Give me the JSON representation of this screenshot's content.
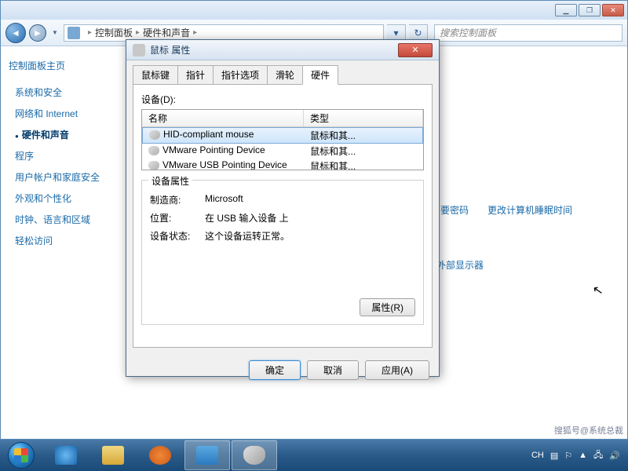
{
  "explorer": {
    "breadcrumb": {
      "seg1": "控制面板",
      "seg2": "硬件和声音"
    },
    "search_placeholder": "搜索控制面板",
    "sidebar": {
      "title": "控制面板主页",
      "items": [
        {
          "label": "系统和安全"
        },
        {
          "label": "网络和 Internet"
        },
        {
          "label": "硬件和声音"
        },
        {
          "label": "程序"
        },
        {
          "label": "用户帐户和家庭安全"
        },
        {
          "label": "外观和个性化"
        },
        {
          "label": "时钟、语言和区域"
        },
        {
          "label": "轻松访问"
        }
      ],
      "active_index": 2
    },
    "bg_links": {
      "l1": "要密码",
      "l2": "更改计算机睡眠时间",
      "l3": "外部显示器"
    }
  },
  "dialog": {
    "title": "鼠标 属性",
    "tabs": [
      {
        "label": "鼠标键"
      },
      {
        "label": "指针"
      },
      {
        "label": "指针选项"
      },
      {
        "label": "滑轮"
      },
      {
        "label": "硬件"
      }
    ],
    "active_tab": 4,
    "devices_label": "设备(D):",
    "columns": {
      "name": "名称",
      "type": "类型"
    },
    "devices": [
      {
        "name": "HID-compliant mouse",
        "type": "鼠标和其..."
      },
      {
        "name": "VMware Pointing Device",
        "type": "鼠标和其..."
      },
      {
        "name": "VMware USB Pointing Device",
        "type": "鼠标和其..."
      }
    ],
    "selected_device": 0,
    "group_title": "设备属性",
    "props": {
      "mfr_label": "制造商:",
      "mfr_value": "Microsoft",
      "loc_label": "位置:",
      "loc_value": "在 USB 输入设备 上",
      "status_label": "设备状态:",
      "status_value": "这个设备运转正常。"
    },
    "prop_btn": "属性(R)",
    "buttons": {
      "ok": "确定",
      "cancel": "取消",
      "apply": "应用(A)"
    }
  },
  "taskbar": {
    "ime": "CH",
    "watermark": "搜狐号@系统总裁"
  }
}
